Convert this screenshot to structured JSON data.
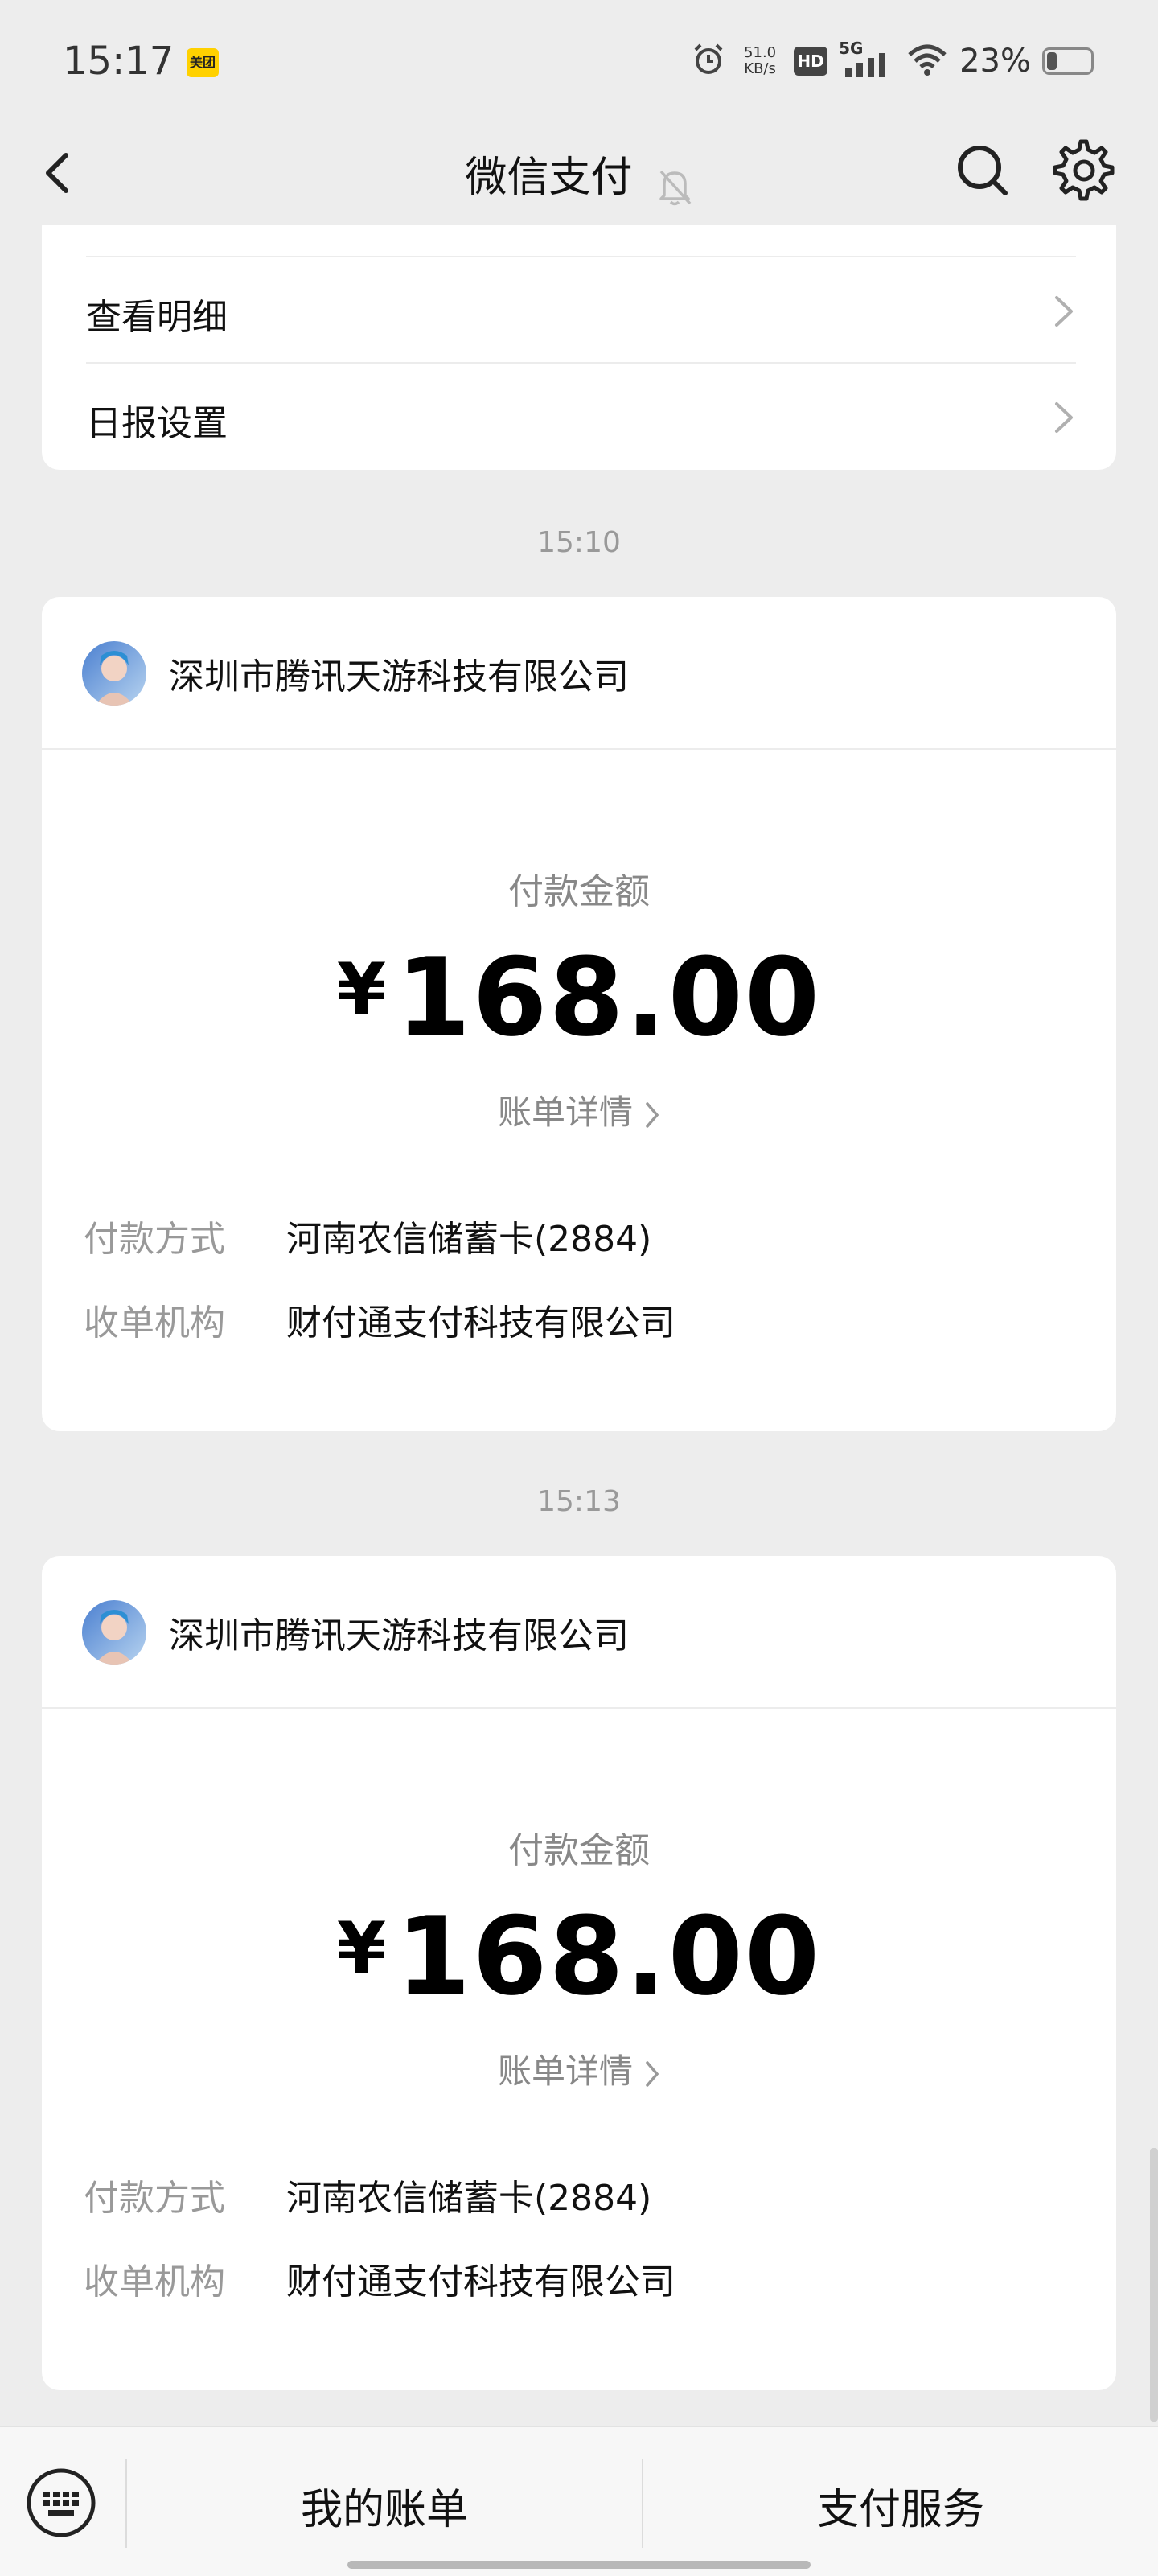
{
  "status_bar": {
    "time": "15:17",
    "app_badge": "美团",
    "net_speed_value": "51.0",
    "net_speed_unit": "KB/s",
    "hd": "HD",
    "network": "5G",
    "battery_percent": "23%",
    "battery_level": 0.23
  },
  "nav": {
    "title": "微信支付"
  },
  "top_menu": [
    {
      "label": "查看明细"
    },
    {
      "label": "日报设置"
    }
  ],
  "messages": [
    {
      "time": "15:10",
      "merchant": "深圳市腾讯天游科技有限公司",
      "amount_label": "付款金额",
      "currency": "¥",
      "amount": "168.00",
      "detail_link": "账单详情",
      "rows": [
        {
          "key": "付款方式",
          "value": "河南农信储蓄卡(2884)"
        },
        {
          "key": "收单机构",
          "value": "财付通支付科技有限公司"
        }
      ]
    },
    {
      "time": "15:13",
      "merchant": "深圳市腾讯天游科技有限公司",
      "amount_label": "付款金额",
      "currency": "¥",
      "amount": "168.00",
      "detail_link": "账单详情",
      "rows": [
        {
          "key": "付款方式",
          "value": "河南农信储蓄卡(2884)"
        },
        {
          "key": "收单机构",
          "value": "财付通支付科技有限公司"
        }
      ]
    }
  ],
  "bottom_bar": {
    "my_bill": "我的账单",
    "pay_service": "支付服务"
  },
  "colors": {
    "background": "#ededed",
    "card": "#ffffff",
    "secondary_text": "#999999"
  }
}
